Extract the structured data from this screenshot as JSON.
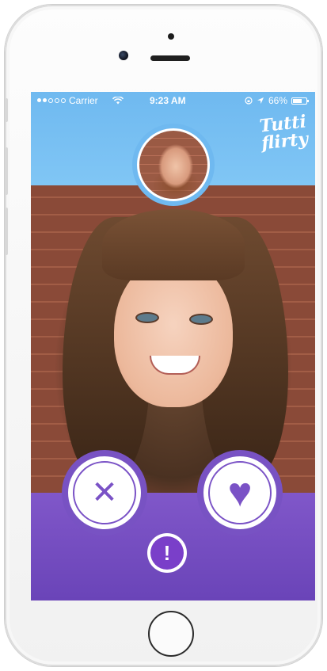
{
  "status_bar": {
    "carrier": "Carrier",
    "time": "9:23 AM",
    "battery": "66%",
    "signal_icon": "signal-dots-icon",
    "wifi_icon": "wifi-icon",
    "location_icon": "location-arrow-icon",
    "lock_icon": "rotation-lock-icon",
    "battery_icon": "battery-icon"
  },
  "app": {
    "logo_line1": "Tutti",
    "logo_line2": "flirty"
  },
  "actions": {
    "dislike_glyph": "✕",
    "like_glyph": "♥",
    "report_glyph": "!"
  },
  "colors": {
    "header": "#6fb9f0",
    "accent_purple": "#7a52c6",
    "panel": "#7852c3"
  }
}
